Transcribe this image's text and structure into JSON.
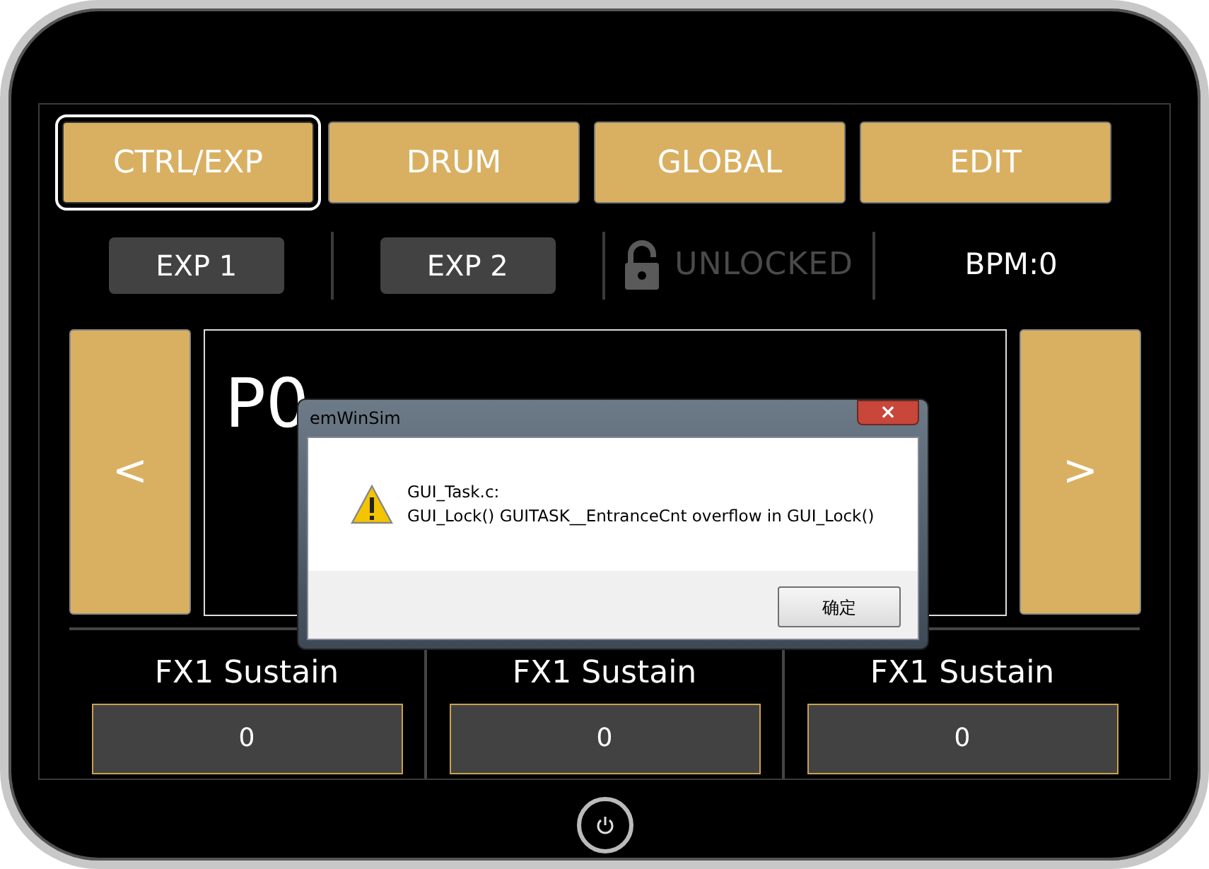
{
  "tabs": [
    {
      "label": "CTRL/EXP",
      "selected": true
    },
    {
      "label": "DRUM",
      "selected": false
    },
    {
      "label": "GLOBAL",
      "selected": false
    },
    {
      "label": "EDIT",
      "selected": false
    }
  ],
  "expression_buttons": [
    "EXP 1",
    "EXP 2"
  ],
  "lock": {
    "label": "UNLOCKED",
    "locked": false
  },
  "bpm": "BPM:0",
  "nav": {
    "prev": "<",
    "next": ">"
  },
  "display": {
    "preset": "P0"
  },
  "parameters": [
    {
      "label": "FX1 Sustain",
      "value": "0"
    },
    {
      "label": "FX1 Sustain",
      "value": "0"
    },
    {
      "label": "FX1 Sustain",
      "value": "0"
    }
  ],
  "dialog": {
    "title": "emWinSim",
    "close": "×",
    "message_lines": [
      "GUI_Task.c:",
      "GUI_Lock() GUITASK__EntranceCnt overflow in GUI_Lock()"
    ],
    "ok": "确定"
  }
}
